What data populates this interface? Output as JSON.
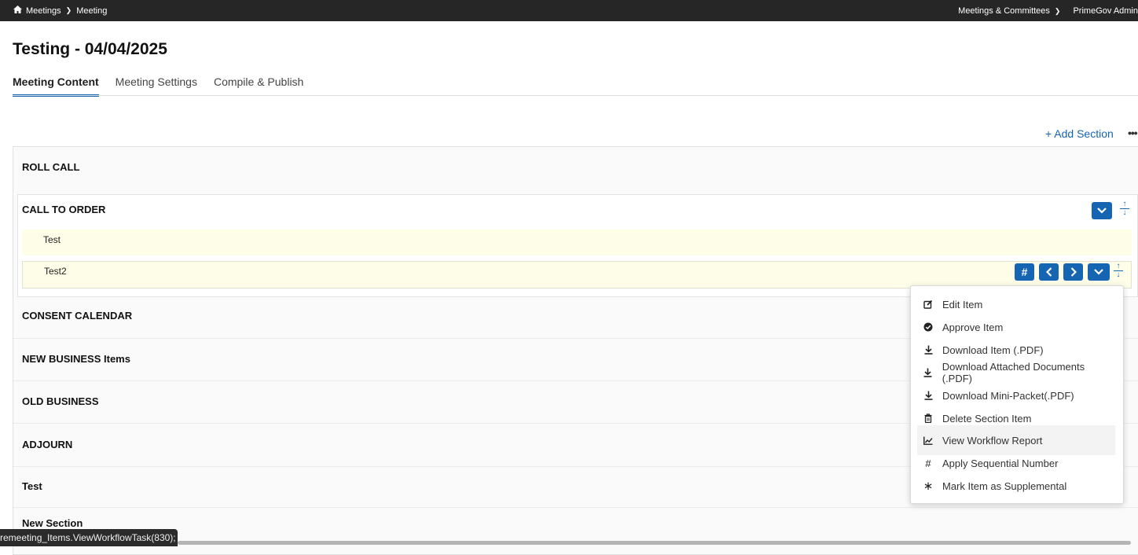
{
  "breadcrumb": {
    "home": "Meetings",
    "current": "Meeting"
  },
  "topbar": {
    "menu_label": "Meetings & Committees",
    "user_label": "PrimeGov Admin"
  },
  "page": {
    "title": "Testing - 04/04/2025"
  },
  "tabs": [
    {
      "label": "Meeting Content",
      "active": true
    },
    {
      "label": "Meeting Settings",
      "active": false
    },
    {
      "label": "Compile & Publish",
      "active": false
    }
  ],
  "actions": {
    "add_section": "+ Add Section",
    "more": "•••"
  },
  "sections": {
    "roll_call": "ROLL CALL",
    "call_to_order": "CALL TO ORDER",
    "consent_calendar": "CONSENT CALENDAR",
    "new_business": "NEW BUSINESS Items",
    "old_business": "OLD BUSINESS",
    "adjourn": "ADJOURN",
    "test": "Test",
    "new_section": "New Section"
  },
  "items": [
    {
      "label": "Test"
    },
    {
      "label": "Test2"
    }
  ],
  "item_buttons": {
    "number": "#"
  },
  "context_menu": [
    {
      "label": "Edit Item",
      "icon": "edit-icon"
    },
    {
      "label": "Approve Item",
      "icon": "check-circle-icon"
    },
    {
      "label": "Download Item (.PDF)",
      "icon": "download-icon"
    },
    {
      "label": "Download Attached Documents (.PDF)",
      "icon": "download-icon"
    },
    {
      "label": "Download Mini-Packet(.PDF)",
      "icon": "download-icon"
    },
    {
      "label": "Delete Section Item",
      "icon": "trash-icon"
    },
    {
      "label": "View Workflow Report",
      "icon": "chart-line-icon"
    },
    {
      "label": "Apply Sequential Number",
      "icon": "hash-icon"
    },
    {
      "label": "Mark Item as Supplemental",
      "icon": "asterisk-icon"
    }
  ],
  "status_bar": {
    "text": "remeeting_Items.ViewWorkflowTask(830);"
  },
  "colors": {
    "accent": "#1565b3",
    "topbar": "#262626",
    "item_highlight": "#fefde8"
  }
}
